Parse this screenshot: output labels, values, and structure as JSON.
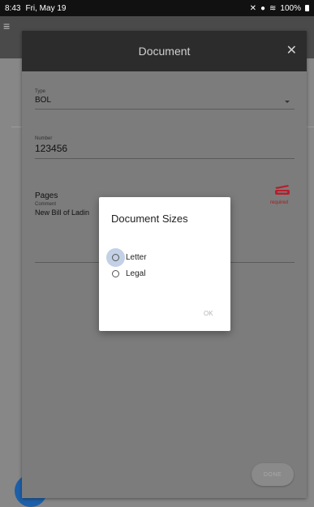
{
  "status_bar": {
    "time": "8:43",
    "date": "Fri, May 19",
    "battery": "100%"
  },
  "sheet": {
    "title": "Document",
    "type_field": {
      "label": "Type",
      "value": "BOL"
    },
    "number_field": {
      "label": "Number",
      "value": "123456"
    },
    "pages_label": "Pages",
    "required_text": "required",
    "comment_field": {
      "label": "Comment",
      "value": "New Bill of Ladin"
    },
    "done_label": "DONE"
  },
  "dialog": {
    "title": "Document Sizes",
    "options": [
      {
        "label": "Letter",
        "selected": false,
        "focused": true
      },
      {
        "label": "Legal",
        "selected": false,
        "focused": false
      }
    ],
    "ok_label": "OK"
  },
  "colors": {
    "header_bg": "#2c2c2c",
    "required": "#a02020",
    "fab": "#1d5fa8"
  },
  "icons": [
    "menu-icon",
    "close-icon",
    "dropdown-caret-icon",
    "scanner-icon",
    "wifi-icon",
    "location-icon",
    "mute-icon",
    "battery-icon"
  ]
}
